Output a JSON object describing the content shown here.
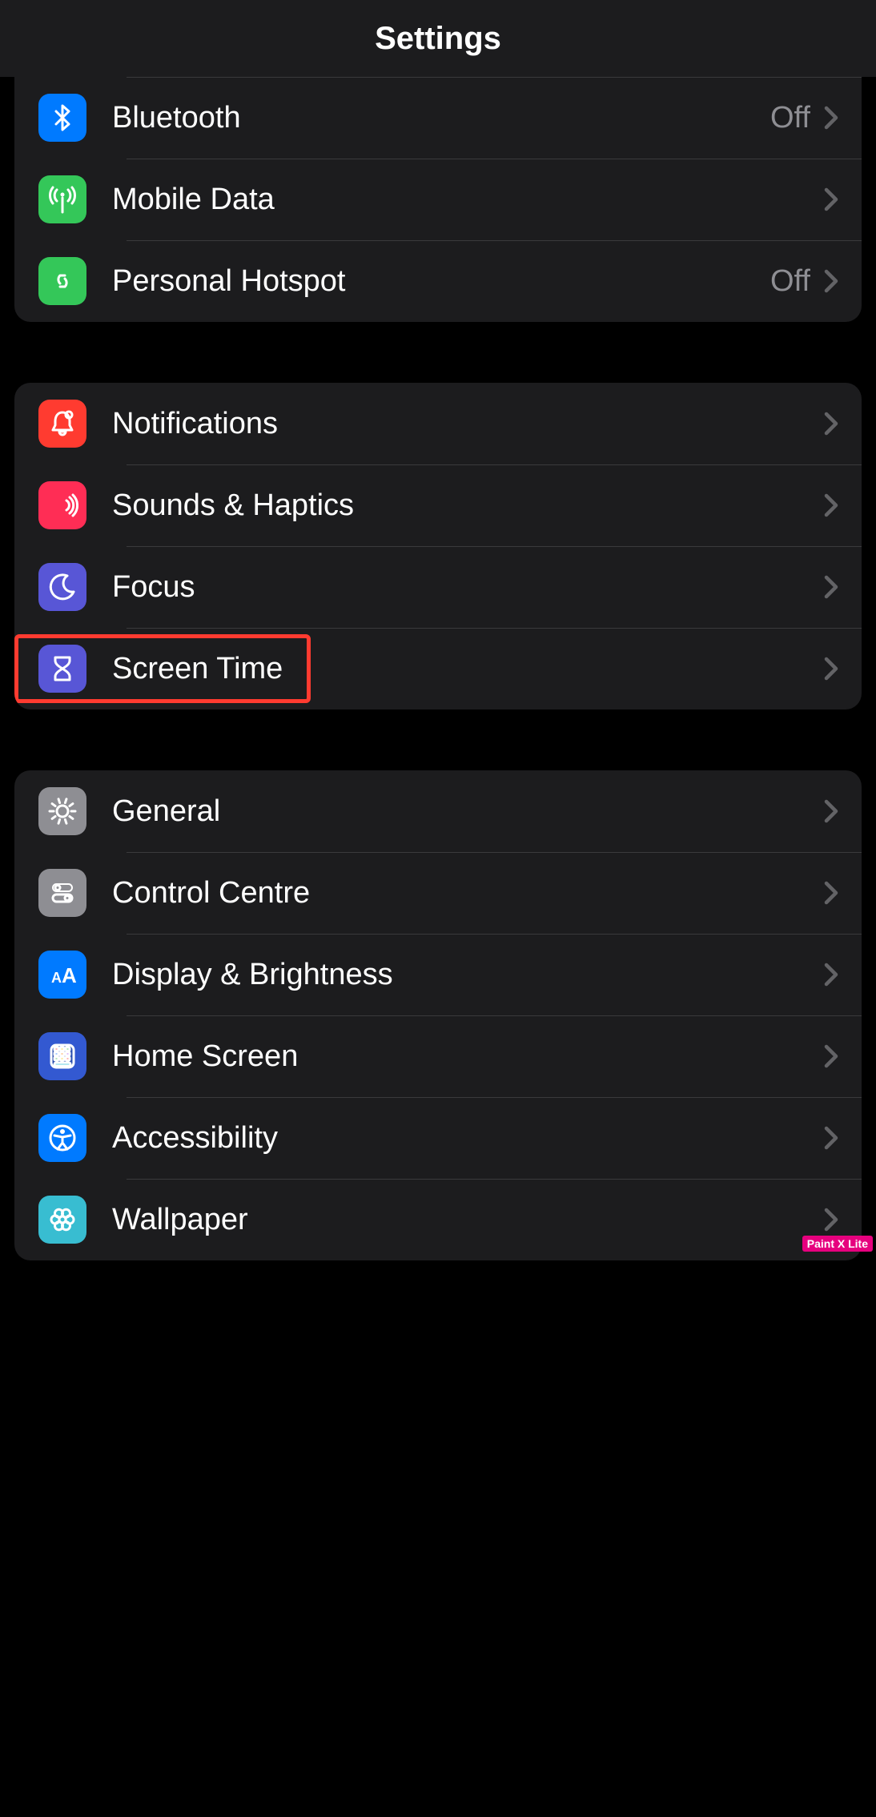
{
  "header": {
    "title": "Settings"
  },
  "groups": [
    {
      "id": "connectivity",
      "rows": [
        {
          "id": "bluetooth",
          "label": "Bluetooth",
          "value": "Off",
          "icon": "bluetooth",
          "icon_bg": "#007aff"
        },
        {
          "id": "mobile-data",
          "label": "Mobile Data",
          "value": "",
          "icon": "antenna",
          "icon_bg": "#34c759"
        },
        {
          "id": "personal-hotspot",
          "label": "Personal Hotspot",
          "value": "Off",
          "icon": "link",
          "icon_bg": "#34c759"
        }
      ]
    },
    {
      "id": "attention",
      "rows": [
        {
          "id": "notifications",
          "label": "Notifications",
          "value": "",
          "icon": "bell",
          "icon_bg": "#ff3b30"
        },
        {
          "id": "sounds-haptics",
          "label": "Sounds & Haptics",
          "value": "",
          "icon": "speaker",
          "icon_bg": "#ff2d55"
        },
        {
          "id": "focus",
          "label": "Focus",
          "value": "",
          "icon": "moon",
          "icon_bg": "#5856d6"
        },
        {
          "id": "screen-time",
          "label": "Screen Time",
          "value": "",
          "icon": "hourglass",
          "icon_bg": "#5856d6",
          "highlighted": true
        }
      ]
    },
    {
      "id": "system",
      "rows": [
        {
          "id": "general",
          "label": "General",
          "value": "",
          "icon": "gear",
          "icon_bg": "#8e8e93"
        },
        {
          "id": "control-centre",
          "label": "Control Centre",
          "value": "",
          "icon": "switches",
          "icon_bg": "#8e8e93"
        },
        {
          "id": "display-brightness",
          "label": "Display & Brightness",
          "value": "",
          "icon": "aa",
          "icon_bg": "#007aff"
        },
        {
          "id": "home-screen",
          "label": "Home Screen",
          "value": "",
          "icon": "grid",
          "icon_bg": "#3359d1"
        },
        {
          "id": "accessibility",
          "label": "Accessibility",
          "value": "",
          "icon": "accessibility",
          "icon_bg": "#007aff"
        },
        {
          "id": "wallpaper",
          "label": "Wallpaper",
          "value": "",
          "icon": "flower",
          "icon_bg": "#38bdd1"
        }
      ]
    }
  ],
  "watermark": "Paint X Lite"
}
